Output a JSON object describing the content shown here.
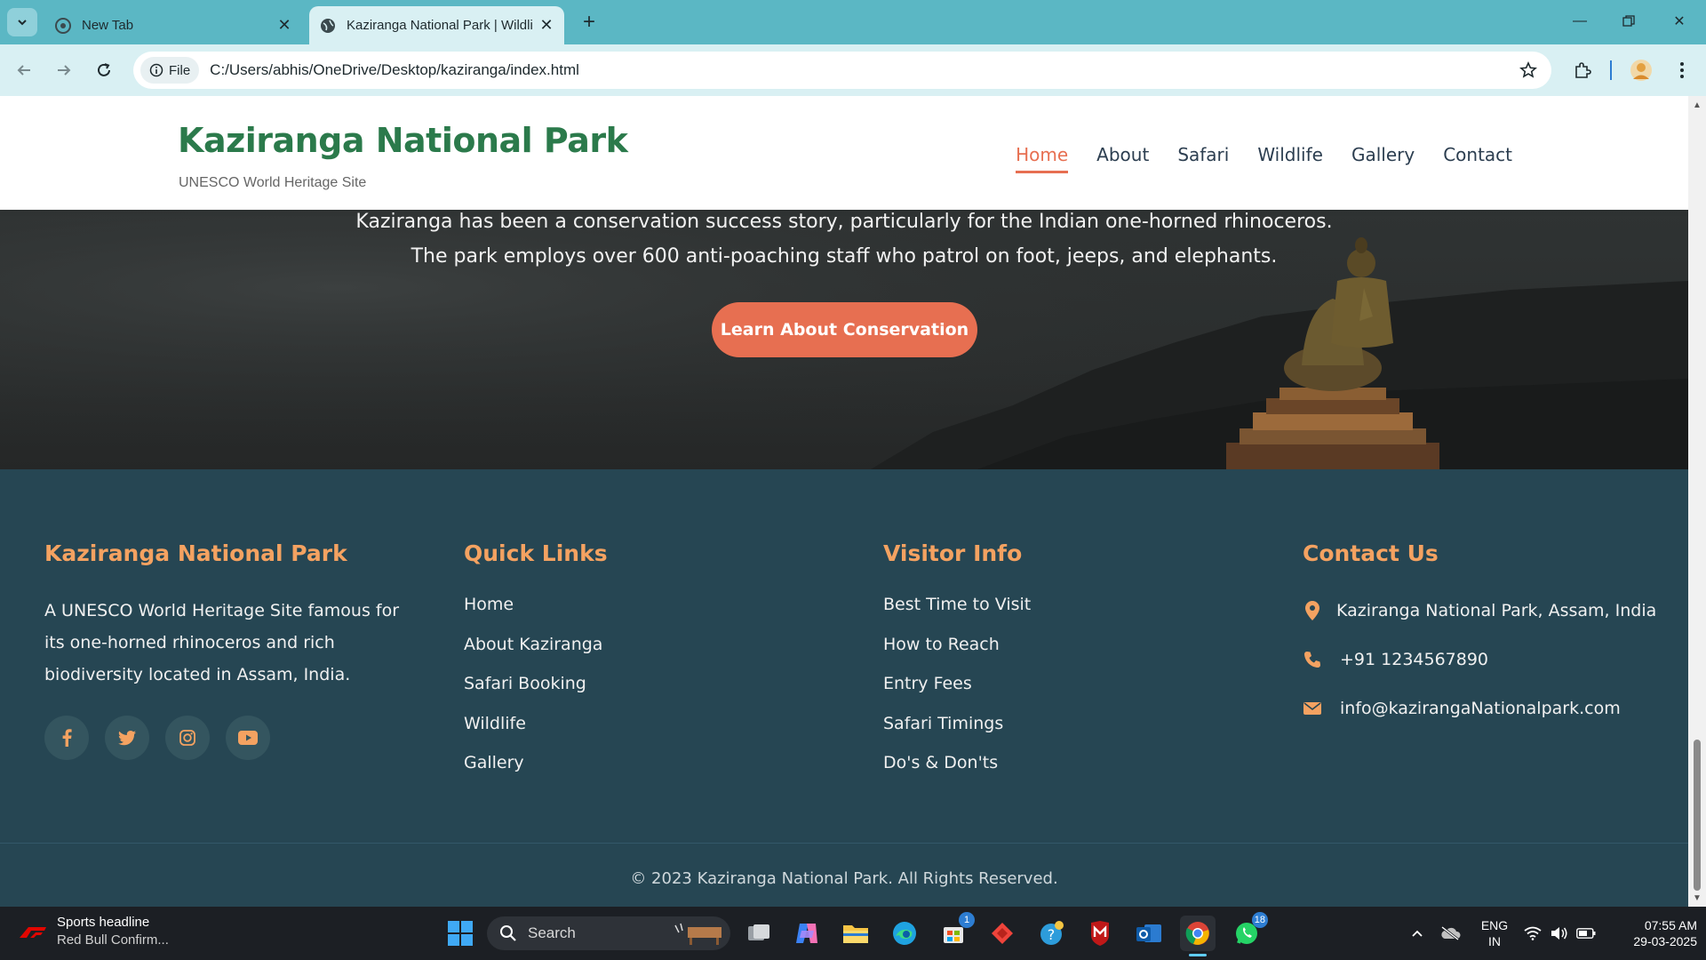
{
  "browser": {
    "tabs": [
      {
        "title": "New Tab",
        "active": false
      },
      {
        "title": "Kaziranga National Park | Wildli",
        "active": true
      }
    ],
    "site_chip": "File",
    "url": "C:/Users/abhis/OneDrive/Desktop/kaziranga/index.html"
  },
  "site": {
    "logo_title": "Kaziranga National Park",
    "logo_subtitle": "UNESCO World Heritage Site",
    "nav": [
      "Home",
      "About",
      "Safari",
      "Wildlife",
      "Gallery",
      "Contact"
    ],
    "active_nav": "Home"
  },
  "hero": {
    "text": "Kaziranga has been a conservation success story, particularly for the Indian one-horned rhinoceros. The park employs over 600 anti-poaching staff who patrol on foot, jeeps, and elephants.",
    "button": "Learn About Conservation"
  },
  "footer": {
    "about": {
      "heading": "Kaziranga National Park",
      "text": "A UNESCO World Heritage Site famous for its one-horned rhinoceros and rich biodiversity located in Assam, India.",
      "socials": [
        "facebook-icon",
        "twitter-icon",
        "instagram-icon",
        "youtube-icon"
      ]
    },
    "quick_links": {
      "heading": "Quick Links",
      "items": [
        "Home",
        "About Kaziranga",
        "Safari Booking",
        "Wildlife",
        "Gallery"
      ]
    },
    "visitor_info": {
      "heading": "Visitor Info",
      "items": [
        "Best Time to Visit",
        "How to Reach",
        "Entry Fees",
        "Safari Timings",
        "Do's & Don'ts"
      ]
    },
    "contact": {
      "heading": "Contact Us",
      "address": "Kaziranga National Park, Assam, India",
      "phone": "+91 1234567890",
      "email": "info@kazirangaNationalpark.com"
    },
    "copyright": "© 2023 Kaziranga National Park. All Rights Reserved."
  },
  "taskbar": {
    "news_title": "Sports headline",
    "news_sub": "Red Bull Confirm...",
    "search_placeholder": "Search",
    "badges": {
      "store": "1",
      "whatsapp": "18"
    },
    "lang_1": "ENG",
    "lang_2": "IN",
    "time": "07:55 AM",
    "date": "29-03-2025"
  },
  "colors": {
    "brand_green": "#2b7a4b",
    "accent_orange": "#e76f51",
    "footer_heading": "#f4a261",
    "footer_bg": "#264653",
    "browser_frame": "#5bb7c4"
  }
}
